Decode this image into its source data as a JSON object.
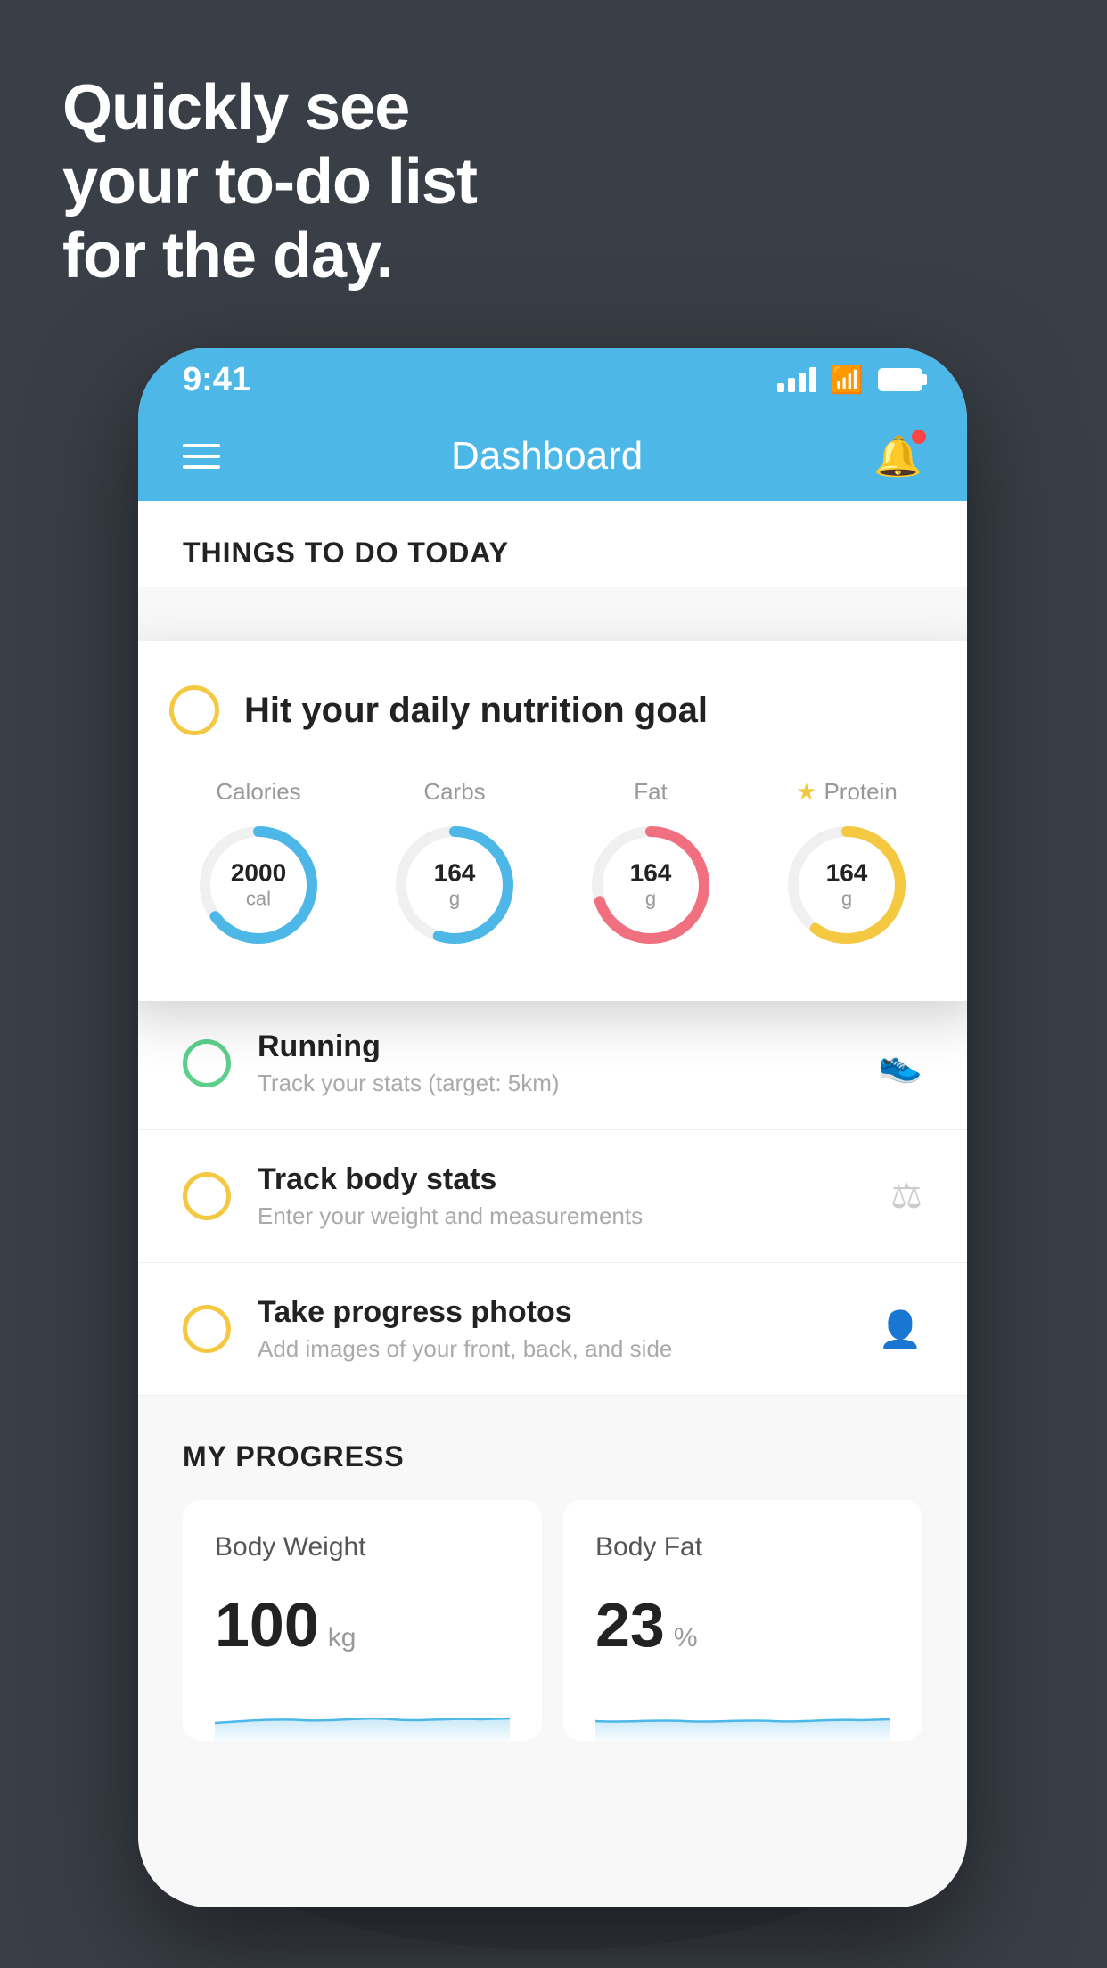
{
  "hero": {
    "line1": "Quickly see",
    "line2": "your to-do list",
    "line3": "for the day."
  },
  "phone": {
    "status_bar": {
      "time": "9:41"
    },
    "nav": {
      "title": "Dashboard"
    },
    "things_section": {
      "header": "THINGS TO DO TODAY"
    },
    "floating_card": {
      "title": "Hit your daily nutrition goal",
      "nutrition": [
        {
          "label": "Calories",
          "value": "2000",
          "unit": "cal",
          "color": "blue",
          "starred": false,
          "progress": 0.65
        },
        {
          "label": "Carbs",
          "value": "164",
          "unit": "g",
          "color": "blue",
          "starred": false,
          "progress": 0.55
        },
        {
          "label": "Fat",
          "value": "164",
          "unit": "g",
          "color": "red",
          "starred": false,
          "progress": 0.7
        },
        {
          "label": "Protein",
          "value": "164",
          "unit": "g",
          "color": "yellow",
          "starred": true,
          "progress": 0.6
        }
      ]
    },
    "todo_items": [
      {
        "label": "Running",
        "sub": "Track your stats (target: 5km)",
        "circle_color": "green",
        "icon": "👟"
      },
      {
        "label": "Track body stats",
        "sub": "Enter your weight and measurements",
        "circle_color": "yellow",
        "icon": "⚖"
      },
      {
        "label": "Take progress photos",
        "sub": "Add images of your front, back, and side",
        "circle_color": "yellow",
        "icon": "👤"
      }
    ],
    "progress_section": {
      "header": "MY PROGRESS",
      "cards": [
        {
          "title": "Body Weight",
          "value": "100",
          "unit": "kg"
        },
        {
          "title": "Body Fat",
          "value": "23",
          "unit": "%"
        }
      ]
    }
  }
}
